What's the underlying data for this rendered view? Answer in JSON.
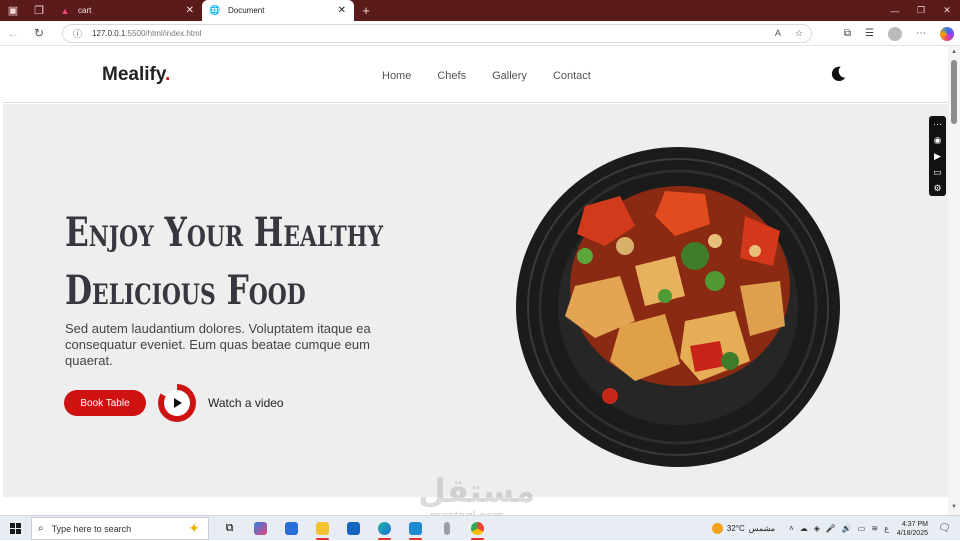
{
  "browser": {
    "tabs": [
      {
        "title": "cart",
        "active": false
      },
      {
        "title": "Document",
        "active": true
      }
    ],
    "url_host": "127.0.0.1",
    "url_path": ":5500/html/index.html",
    "new_tab_symbol": "+"
  },
  "site": {
    "logo": "Mealify",
    "logo_dot": ".",
    "nav": [
      "Home",
      "Chefs",
      "Gallery",
      "Contact"
    ],
    "theme_icon": "moon-icon"
  },
  "hero": {
    "title_line1": "Enjoy Your Healthy",
    "title_line2": "Delicious Food",
    "subtitle": "Sed autem laudantium dolores. Voluptatem itaque ea consequatur eveniet. Eum quas beatae cumque eum quaerat.",
    "book_button": "Book Table",
    "watch_link": "Watch a video",
    "accent_color": "#ce1212"
  },
  "watermark": {
    "arabic": "مستقل",
    "latin": "mostaql.com"
  },
  "taskbar": {
    "search_placeholder": "Type here to search",
    "weather_temp": "32°C",
    "weather_text": "مشمس",
    "time": "4:37 PM",
    "date": "4/18/2025",
    "lang": "ع"
  }
}
